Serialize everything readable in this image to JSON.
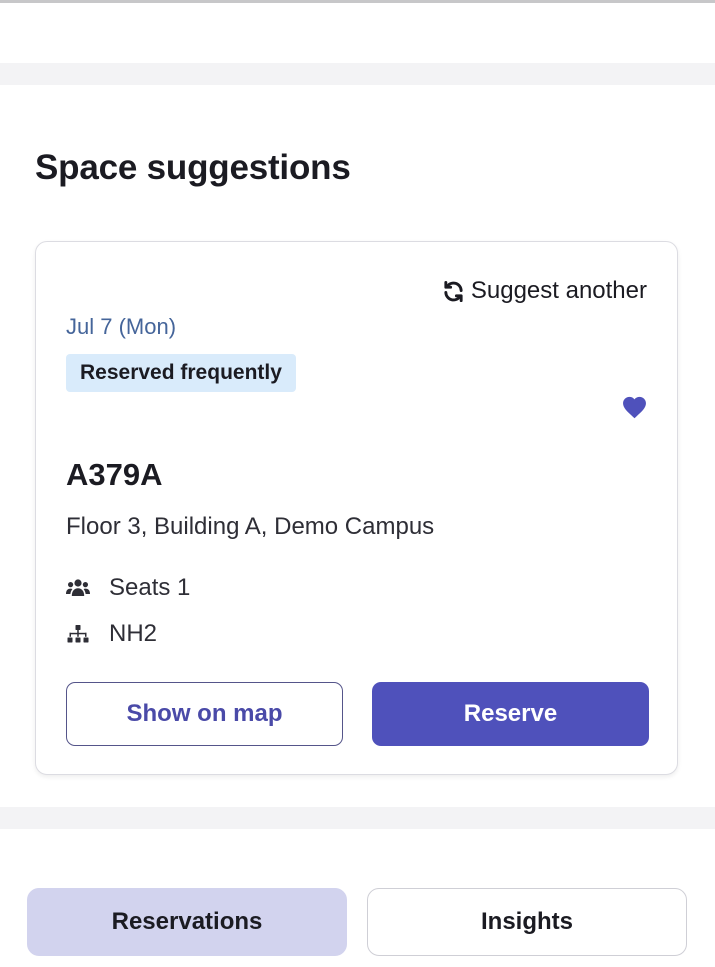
{
  "section": {
    "title": "Space suggestions"
  },
  "suggestion_card": {
    "suggest_another_label": "Suggest another",
    "date": "Jul 7 (Mon)",
    "badge": "Reserved frequently",
    "favorite": true,
    "space_name": "A379A",
    "location": "Floor 3, Building A, Demo Campus",
    "details": {
      "seats": "Seats 1",
      "org_unit": "NH2"
    },
    "actions": {
      "show_on_map": "Show on map",
      "reserve": "Reserve"
    }
  },
  "bottom_tabs": {
    "reservations": "Reservations",
    "insights": "Insights",
    "selected": "Reservations"
  },
  "colors": {
    "primary": "#4f51bb",
    "date_text": "#45659a",
    "badge_bg": "#d9ebfb",
    "selected_tab_bg": "#d2d3ee",
    "section_divider": "#f3f3f5"
  },
  "icons": {
    "suggest_another": "refresh-icon",
    "favorite": "heart-icon",
    "seats": "users-icon",
    "org_unit": "sitemap-icon"
  }
}
